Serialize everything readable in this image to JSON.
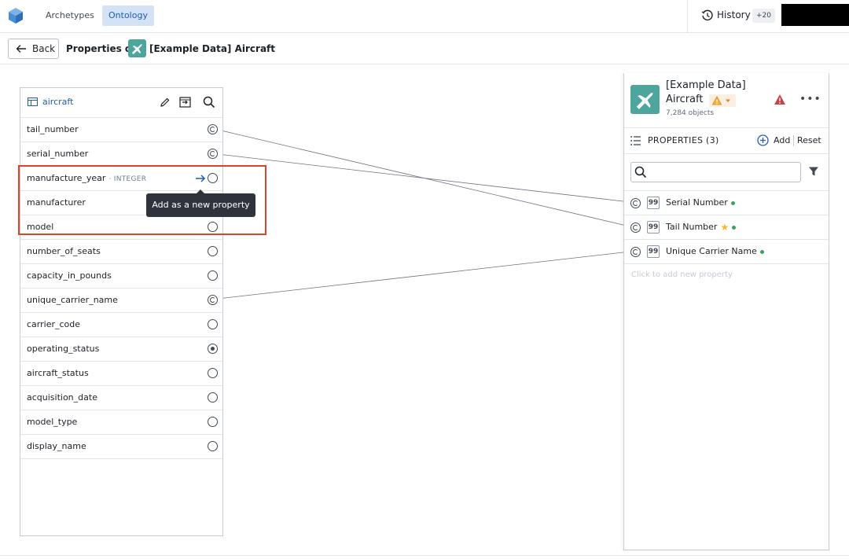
{
  "topbar": {
    "tabs": [
      {
        "label": "Archetypes",
        "active": false
      },
      {
        "label": "Ontology",
        "active": true
      }
    ],
    "history_label": "History",
    "history_badge": "+20"
  },
  "subheader": {
    "back_label": "Back",
    "properties_of": "Properties of",
    "object_title": "[Example Data] Aircraft"
  },
  "dataset": {
    "name": "aircraft",
    "columns": [
      {
        "name": "tail_number",
        "state": "linked"
      },
      {
        "name": "serial_number",
        "state": "linked"
      },
      {
        "name": "manufacture_year",
        "type": "· INTEGER",
        "state": "empty",
        "hovered": true
      },
      {
        "name": "manufacturer",
        "state": "empty"
      },
      {
        "name": "model",
        "state": "empty"
      },
      {
        "name": "number_of_seats",
        "state": "empty"
      },
      {
        "name": "capacity_in_pounds",
        "state": "empty"
      },
      {
        "name": "unique_carrier_name",
        "state": "linked"
      },
      {
        "name": "carrier_code",
        "state": "empty"
      },
      {
        "name": "operating_status",
        "state": "selected"
      },
      {
        "name": "aircraft_status",
        "state": "empty"
      },
      {
        "name": "acquisition_date",
        "state": "empty"
      },
      {
        "name": "model_type",
        "state": "empty"
      },
      {
        "name": "display_name",
        "state": "empty"
      }
    ],
    "tooltip": "Add as a new property"
  },
  "object_panel": {
    "name_line1": "[Example Data]",
    "name_line2": "Aircraft",
    "object_count": "7,284 objects",
    "properties_title": "PROPERTIES (3)",
    "add_label": "Add",
    "reset_label": "Reset",
    "search": {
      "value": "",
      "placeholder": ""
    },
    "properties": [
      {
        "name": "Serial Number",
        "starred": false
      },
      {
        "name": "Tail Number",
        "starred": true
      },
      {
        "name": "Unique Carrier Name",
        "starred": false
      }
    ],
    "click_to_add": "Click to add new property"
  },
  "colors": {
    "accent": "#215db0",
    "object_icon": "#4ea59d",
    "highlight": "#d9442a",
    "status_ok": "#3da05a",
    "warning": "#d9822b",
    "error": "#cd4246"
  }
}
